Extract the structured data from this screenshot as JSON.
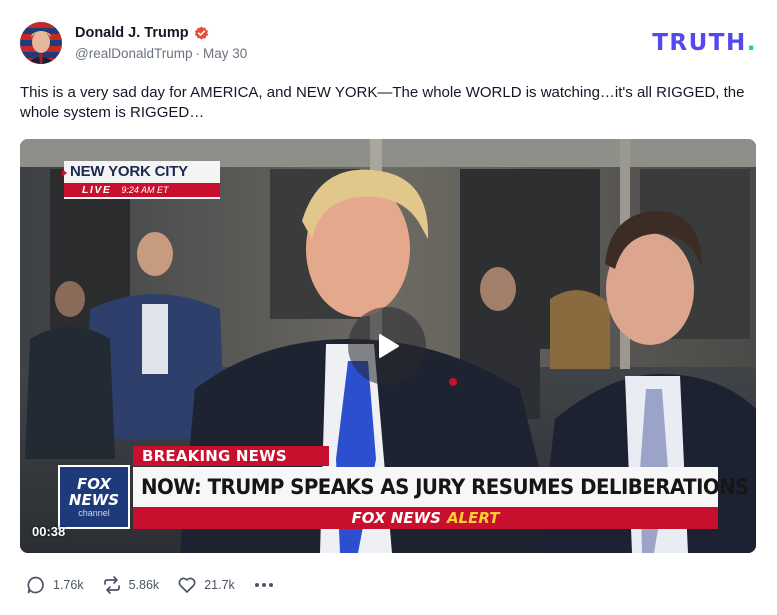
{
  "author": {
    "name": "Donald J. Trump",
    "handle": "@realDonaldTrump",
    "separator": "·",
    "date": "May 30",
    "verified_icon": "verified-badge-icon",
    "verified_color": "#e74c3c"
  },
  "brand": {
    "name": "TRUTH",
    "dot": ".",
    "color": "#5448ee",
    "dot_color": "#26c7a7"
  },
  "post": {
    "text": "This is a very sad day for AMERICA, and NEW YORK—The whole WORLD is watching…it's all RIGGED, the whole system is RIGGED…"
  },
  "video": {
    "location": "NEW YORK CITY",
    "live_label": "LIVE",
    "live_time": "9:24 AM ET",
    "breaking_label": "BREAKING NEWS",
    "headline": "NOW: TRUMP SPEAKS AS JURY RESUMES DELIBERATIONS",
    "alert_brand": "FOX NEWS",
    "alert_label": "ALERT",
    "network_logo_line1": "FOX",
    "network_logo_line2": "NEWS",
    "network_logo_line3": "channel",
    "duration": "00:38",
    "play_icon": "play-icon",
    "accent_red": "#c8102e"
  },
  "actions": {
    "replies": "1.76k",
    "retruths": "5.86k",
    "likes": "21.7k",
    "reply_icon": "comment-icon",
    "retruth_icon": "retruth-icon",
    "like_icon": "heart-icon",
    "more_icon": "more-icon"
  }
}
